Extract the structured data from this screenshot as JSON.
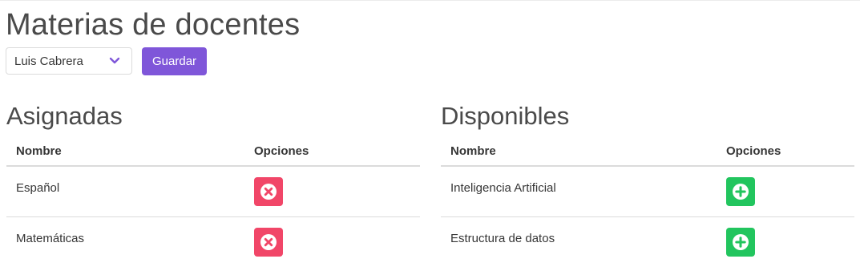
{
  "page": {
    "title": "Materias de docentes"
  },
  "controls": {
    "teacher_select": {
      "value": "Luis Cabrera",
      "icon": "chevron-down-icon"
    },
    "save_label": "Guardar"
  },
  "assigned": {
    "title": "Asignadas",
    "headers": {
      "name": "Nombre",
      "options": "Opciones"
    },
    "rows": [
      {
        "name": "Español",
        "action_icon": "remove-circle-icon"
      },
      {
        "name": "Matemáticas",
        "action_icon": "remove-circle-icon"
      }
    ]
  },
  "available": {
    "title": "Disponibles",
    "headers": {
      "name": "Nombre",
      "options": "Opciones"
    },
    "rows": [
      {
        "name": "Inteligencia Artificial",
        "action_icon": "add-circle-icon"
      },
      {
        "name": "Estructura de datos",
        "action_icon": "add-circle-icon"
      }
    ]
  },
  "colors": {
    "primary": "#7f56d9",
    "danger": "#f14668",
    "success": "#22c55e"
  }
}
